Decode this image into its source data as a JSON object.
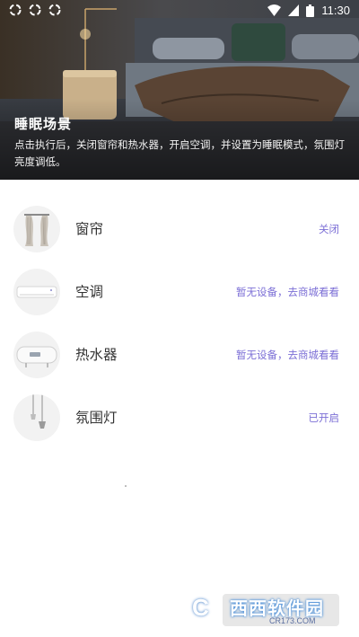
{
  "status_bar": {
    "time": "11:30",
    "left_icons": [
      "notification-icon",
      "notification-icon",
      "notification-icon"
    ],
    "right_icons": [
      "wifi-icon",
      "signal-icon",
      "battery-icon"
    ]
  },
  "scene": {
    "title": "睡眠场景",
    "description": "点击执行后，关闭窗帘和热水器，开启空调，并设置为睡眠模式，氛围灯亮度调低。"
  },
  "devices": [
    {
      "name": "窗帘",
      "status": "关闭",
      "icon": "curtain-icon"
    },
    {
      "name": "空调",
      "status": "暂无设备，去商城看看",
      "icon": "air-conditioner-icon"
    },
    {
      "name": "热水器",
      "status": "暂无设备，去商城看看",
      "icon": "water-heater-icon"
    },
    {
      "name": "氛围灯",
      "status": "已开启",
      "icon": "ambient-lamp-icon"
    }
  ],
  "colors": {
    "accent": "#7c6fd6",
    "text": "#333333",
    "background": "#ffffff"
  },
  "watermark": {
    "logo": "C",
    "text": "西西软件园",
    "sub": "CR173.COM"
  }
}
